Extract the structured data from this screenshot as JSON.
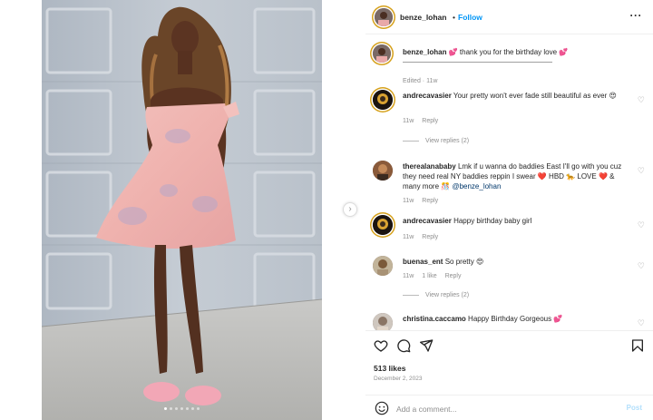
{
  "post": {
    "username": "benze_lohan",
    "follow_label": "Follow",
    "separator": "•",
    "more_icon": "more-horizontal-icon",
    "image_alt": "Woman in pink floral off-shoulder dress posing in front of a garage door",
    "carousel_dots": 7
  },
  "caption": {
    "username": "benze_lohan",
    "text": "thank you for the birthday love",
    "emoji": "💕",
    "emoji_end": "💕",
    "meta": "Edited · 11w"
  },
  "comments": [
    {
      "username": "andrecavasier",
      "text": "Your pretty won't ever fade still beautiful as ever",
      "emoji": "😍",
      "time": "11w",
      "reply_label": "Reply",
      "view_replies": "View replies (2)"
    },
    {
      "username": "therealanababy",
      "text": "Lmk if u wanna do baddies East I'll go with you cuz they need real NY baddies reppin I swear",
      "emoji": "❤️",
      "text2": "HBD",
      "emoji2": "🐆",
      "text3": "LOVE",
      "emoji3": "❤️",
      "text4": "& many more",
      "emoji4": "🎊",
      "mention": "@benze_lohan",
      "time": "11w",
      "reply_label": "Reply"
    },
    {
      "username": "andrecavasier",
      "text": "Happy birthday baby girl",
      "time": "11w",
      "reply_label": "Reply"
    },
    {
      "username": "buenas_ent",
      "text": "So pretty",
      "emoji": "😍",
      "time": "11w",
      "likes": "1 like",
      "reply_label": "Reply",
      "view_replies": "View replies (2)"
    },
    {
      "username": "christina.caccamo",
      "text": "Happy Birthday Gorgeous",
      "emoji": "💕"
    }
  ],
  "actions": {
    "like_icon": "heart-icon",
    "comment_icon": "comment-icon",
    "share_icon": "send-icon",
    "save_icon": "bookmark-icon",
    "likes": "513 likes",
    "date": "December 2, 2023"
  },
  "add_comment": {
    "placeholder": "Add a comment...",
    "post_label": "Post",
    "emoji_icon": "smiley-icon"
  }
}
